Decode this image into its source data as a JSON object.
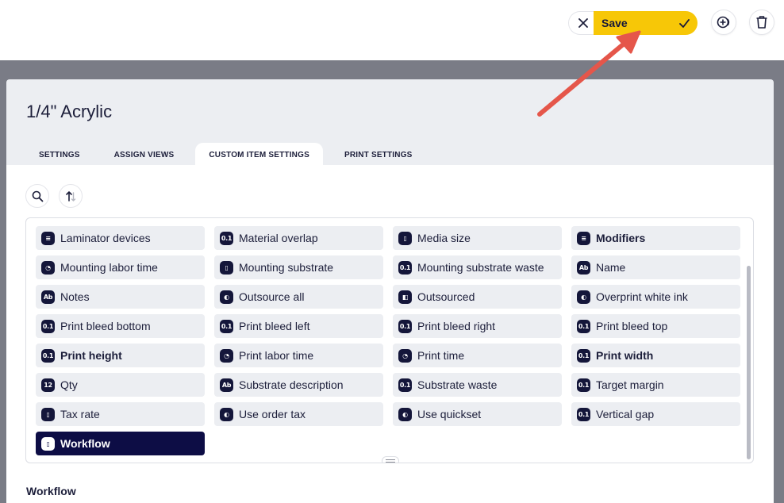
{
  "toolbar": {
    "save_label": "Save",
    "accent_color": "#f7c707"
  },
  "item": {
    "title": "1/4\" Acrylic"
  },
  "tabs": [
    {
      "label": "SETTINGS"
    },
    {
      "label": "ASSIGN VIEWS"
    },
    {
      "label": "CUSTOM ITEM SETTINGS"
    },
    {
      "label": "PRINT SETTINGS"
    }
  ],
  "fields": [
    {
      "label": "Laminator devices",
      "icon": "list-stack-icon",
      "glyph": "≡"
    },
    {
      "label": "Material overlap",
      "icon": "decimal-icon",
      "glyph": "0.1"
    },
    {
      "label": "Media size",
      "icon": "select-icon",
      "glyph": "▯"
    },
    {
      "label": "Modifiers",
      "icon": "list-stack-icon",
      "glyph": "≡"
    },
    {
      "label": "Mounting labor time",
      "icon": "clock-icon",
      "glyph": "◔"
    },
    {
      "label": "Mounting substrate",
      "icon": "select-icon",
      "glyph": "▯"
    },
    {
      "label": "Mounting substrate waste",
      "icon": "decimal-icon",
      "glyph": "0.1"
    },
    {
      "label": "Name",
      "icon": "text-icon",
      "glyph": "Ab"
    },
    {
      "label": "Notes",
      "icon": "text-icon",
      "glyph": "Ab"
    },
    {
      "label": "Outsource all",
      "icon": "toggle-icon",
      "glyph": "◐"
    },
    {
      "label": "Outsourced",
      "icon": "outsource-icon",
      "glyph": "◧"
    },
    {
      "label": "Overprint white ink",
      "icon": "toggle-icon",
      "glyph": "◐"
    },
    {
      "label": "Print bleed bottom",
      "icon": "decimal-icon",
      "glyph": "0.1"
    },
    {
      "label": "Print bleed left",
      "icon": "decimal-icon",
      "glyph": "0.1"
    },
    {
      "label": "Print bleed right",
      "icon": "decimal-icon",
      "glyph": "0.1"
    },
    {
      "label": "Print bleed top",
      "icon": "decimal-icon",
      "glyph": "0.1"
    },
    {
      "label": "Print height",
      "icon": "decimal-icon",
      "glyph": "0.1"
    },
    {
      "label": "Print labor time",
      "icon": "clock-icon",
      "glyph": "◔"
    },
    {
      "label": "Print time",
      "icon": "clock-icon",
      "glyph": "◔"
    },
    {
      "label": "Print width",
      "icon": "decimal-icon",
      "glyph": "0.1"
    },
    {
      "label": "Qty",
      "icon": "integer-icon",
      "glyph": "12"
    },
    {
      "label": "Substrate description",
      "icon": "text-icon",
      "glyph": "Ab"
    },
    {
      "label": "Substrate waste",
      "icon": "decimal-icon",
      "glyph": "0.1"
    },
    {
      "label": "Target margin",
      "icon": "decimal-icon",
      "glyph": "0.1"
    },
    {
      "label": "Tax rate",
      "icon": "select-icon",
      "glyph": "▯"
    },
    {
      "label": "Use order tax",
      "icon": "toggle-icon",
      "glyph": "◐"
    },
    {
      "label": "Use quickset",
      "icon": "toggle-icon",
      "glyph": "◐"
    },
    {
      "label": "Vertical gap",
      "icon": "decimal-icon",
      "glyph": "0.1"
    },
    {
      "label": "Workflow",
      "icon": "select-icon",
      "glyph": "▯"
    }
  ],
  "selected_section": {
    "label": "Workflow"
  }
}
